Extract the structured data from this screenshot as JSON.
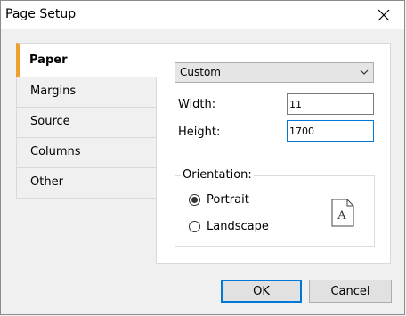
{
  "window": {
    "title": "Page Setup",
    "close_icon": "close-icon"
  },
  "tabs": [
    {
      "label": "Paper",
      "active": true
    },
    {
      "label": "Margins",
      "active": false
    },
    {
      "label": "Source",
      "active": false
    },
    {
      "label": "Columns",
      "active": false
    },
    {
      "label": "Other",
      "active": false
    }
  ],
  "paper": {
    "size_selected": "Custom",
    "width_label": "Width:",
    "width_value": "11",
    "height_label": "Height:",
    "height_value": "1700"
  },
  "orientation": {
    "title": "Orientation:",
    "portrait_label": "Portrait",
    "landscape_label": "Landscape",
    "selected": "Portrait",
    "preview_letter": "A"
  },
  "buttons": {
    "ok_label": "OK",
    "cancel_label": "Cancel"
  },
  "colors": {
    "active_tab_accent": "#f0a030",
    "focus_border": "#0078d7"
  }
}
